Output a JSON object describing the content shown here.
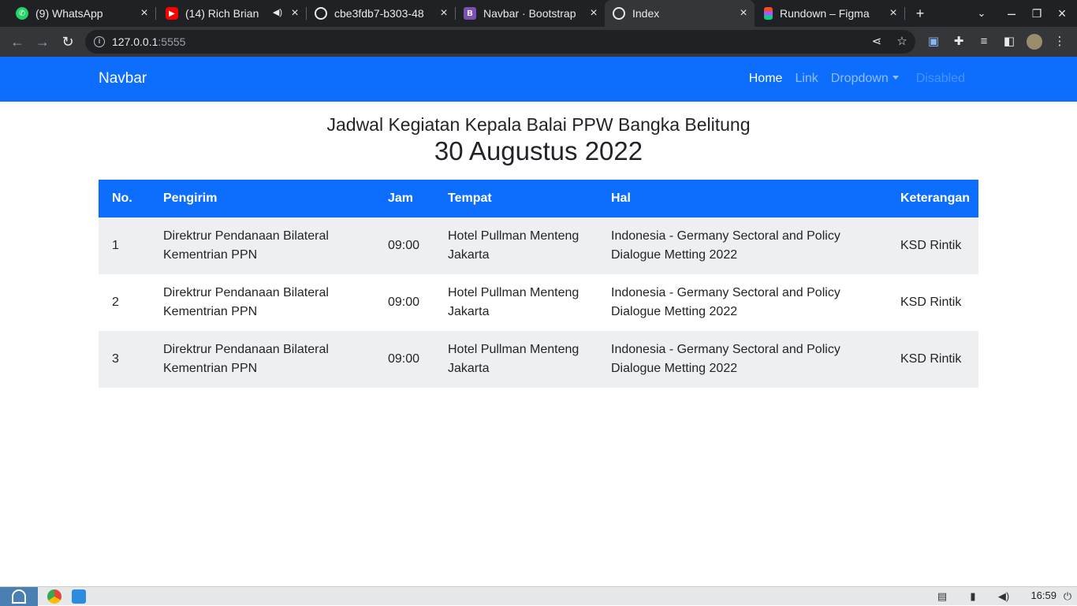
{
  "browser": {
    "tabs": [
      {
        "title": "(9) WhatsApp",
        "icon": "whatsapp-icon",
        "color": "#25d366"
      },
      {
        "title": "(14) Rich Brian",
        "icon": "youtube-icon",
        "color": "#ff0000"
      },
      {
        "title": "cbe3fdb7-b303-48",
        "icon": "globe-icon",
        "color": "#e8eaed"
      },
      {
        "title": "Navbar · Bootstrap",
        "icon": "bootstrap-icon",
        "color": "#7952b3"
      },
      {
        "title": "Index",
        "icon": "broadcast-icon",
        "color": "#e8eaed"
      },
      {
        "title": "Rundown – Figma",
        "icon": "figma-icon",
        "color": "#f24e1e"
      }
    ],
    "url_host": "127.0.0.1",
    "url_port": ":5555"
  },
  "navbar": {
    "brand": "Navbar",
    "links": {
      "home": "Home",
      "link": "Link",
      "dropdown": "Dropdown",
      "disabled": "Disabled"
    }
  },
  "heading": {
    "title": "Jadwal Kegiatan Kepala Balai PPW Bangka Belitung",
    "date": "30 Augustus 2022"
  },
  "table": {
    "headers": {
      "no": "No.",
      "pengirim": "Pengirim",
      "jam": "Jam",
      "tempat": "Tempat",
      "hal": "Hal",
      "keterangan": "Keterangan"
    },
    "rows": [
      {
        "no": "1",
        "pengirim": "Direktrur Pendanaan Bilateral Kementrian PPN",
        "jam": "09:00",
        "tempat": "Hotel Pullman Menteng Jakarta",
        "hal": "Indonesia - Germany Sectoral and Policy Dialogue Metting 2022",
        "keterangan": "KSD Rintik"
      },
      {
        "no": "2",
        "pengirim": "Direktrur Pendanaan Bilateral Kementrian PPN",
        "jam": "09:00",
        "tempat": "Hotel Pullman Menteng Jakarta",
        "hal": "Indonesia - Germany Sectoral and Policy Dialogue Metting 2022",
        "keterangan": "KSD Rintik"
      },
      {
        "no": "3",
        "pengirim": "Direktrur Pendanaan Bilateral Kementrian PPN",
        "jam": "09:00",
        "tempat": "Hotel Pullman Menteng Jakarta",
        "hal": "Indonesia - Germany Sectoral and Policy Dialogue Metting 2022",
        "keterangan": "KSD Rintik"
      }
    ]
  },
  "taskbar": {
    "clock": "16:59"
  },
  "colors": {
    "primary": "#0d6efd",
    "stripe": "#eeeff1"
  }
}
